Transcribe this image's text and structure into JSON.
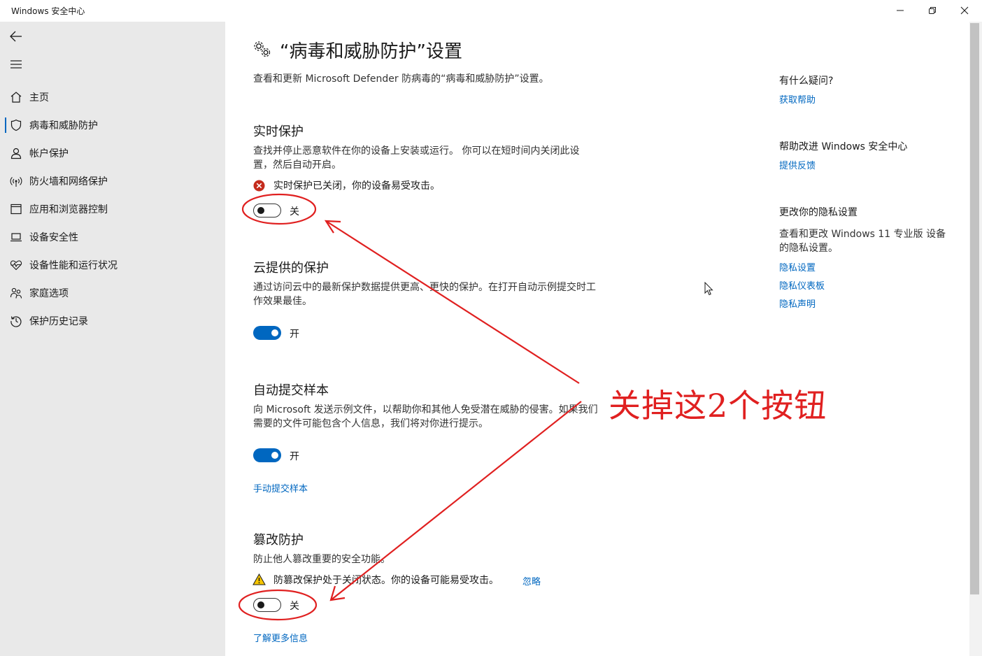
{
  "window": {
    "title": "Windows 安全中心"
  },
  "sidebar": {
    "items": [
      {
        "label": "主页",
        "icon": "home-icon"
      },
      {
        "label": "病毒和威胁防护",
        "icon": "shield-icon"
      },
      {
        "label": "帐户保护",
        "icon": "person-icon"
      },
      {
        "label": "防火墙和网络保护",
        "icon": "wireless-icon"
      },
      {
        "label": "应用和浏览器控制",
        "icon": "app-window-icon"
      },
      {
        "label": "设备安全性",
        "icon": "laptop-icon"
      },
      {
        "label": "设备性能和运行状况",
        "icon": "heart-pulse-icon"
      },
      {
        "label": "家庭选项",
        "icon": "family-icon"
      },
      {
        "label": "保护历史记录",
        "icon": "history-icon"
      }
    ],
    "selected": "病毒和威胁防护"
  },
  "main": {
    "title": "“病毒和威胁防护”设置",
    "subtitle": "查看和更新 Microsoft Defender 防病毒的“病毒和威胁防护”设置。",
    "realtime": {
      "title": "实时保护",
      "desc": "查找并停止恶意软件在你的设备上安装或运行。 你可以在短时间内关闭此设置，然后自动开启。",
      "alert": "实时保护已关闭，你的设备易受攻击。",
      "state": "关"
    },
    "cloud": {
      "title": "云提供的保护",
      "desc": "通过访问云中的最新保护数据提供更高、更快的保护。在打开自动示例提交时工作效果最佳。",
      "state": "开"
    },
    "sample": {
      "title": "自动提交样本",
      "desc": "向 Microsoft 发送示例文件，以帮助你和其他人免受潜在威胁的侵害。如果我们需要的文件可能包含个人信息，我们将对你进行提示。",
      "state": "开",
      "manual_link": "手动提交样本"
    },
    "tamper": {
      "title": "篡改防护",
      "desc": "防止他人篡改重要的安全功能。",
      "alert": "防篡改保护处于关闭状态。你的设备可能易受攻击。",
      "ignore_link": "忽略",
      "state": "关",
      "more_link": "了解更多信息"
    }
  },
  "right": {
    "help_title": "有什么疑问?",
    "help_link": "获取帮助",
    "improve_title": "帮助改进 Windows 安全中心",
    "feedback_link": "提供反馈",
    "privacy_title": "更改你的隐私设置",
    "privacy_desc": "查看和更改 Windows 11 专业版 设备的隐私设置。",
    "privacy_links": [
      "隐私设置",
      "隐私仪表板",
      "隐私声明"
    ]
  },
  "annotation": {
    "text": "关掉这2个按钮",
    "color": "#e02020"
  },
  "colors": {
    "accent": "#0067c0",
    "sidebar_bg": "#e9e9e9",
    "error": "#c42b1c",
    "warning": "#f7c600"
  }
}
